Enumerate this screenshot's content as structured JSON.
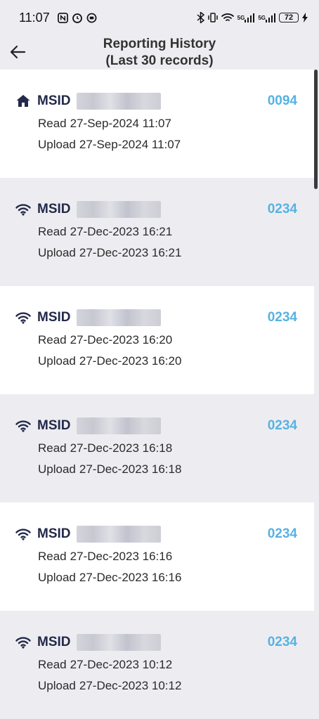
{
  "status_bar": {
    "time": "11:07",
    "battery": "72",
    "signal1": "5G",
    "signal2": "5G"
  },
  "header": {
    "title_line1": "Reporting History",
    "title_line2": "(Last 30 records)"
  },
  "records": [
    {
      "icon": "home-icon",
      "msid_label": "MSID",
      "code": "0094",
      "read_label": "Read",
      "read_time": "27-Sep-2024 11:07",
      "upload_label": "Upload",
      "upload_time": "27-Sep-2024 11:07"
    },
    {
      "icon": "wifi-icon",
      "msid_label": "MSID",
      "code": "0234",
      "read_label": "Read",
      "read_time": "27-Dec-2023 16:21",
      "upload_label": "Upload",
      "upload_time": "27-Dec-2023 16:21"
    },
    {
      "icon": "wifi-icon",
      "msid_label": "MSID",
      "code": "0234",
      "read_label": "Read",
      "read_time": "27-Dec-2023 16:20",
      "upload_label": "Upload",
      "upload_time": "27-Dec-2023 16:20"
    },
    {
      "icon": "wifi-icon",
      "msid_label": "MSID",
      "code": "0234",
      "read_label": "Read",
      "read_time": "27-Dec-2023 16:18",
      "upload_label": "Upload",
      "upload_time": "27-Dec-2023 16:18"
    },
    {
      "icon": "wifi-icon",
      "msid_label": "MSID",
      "code": "0234",
      "read_label": "Read",
      "read_time": "27-Dec-2023 16:16",
      "upload_label": "Upload",
      "upload_time": "27-Dec-2023 16:16"
    },
    {
      "icon": "wifi-icon",
      "msid_label": "MSID",
      "code": "0234",
      "read_label": "Read",
      "read_time": "27-Dec-2023 10:12",
      "upload_label": "Upload",
      "upload_time": "27-Dec-2023 10:12"
    }
  ],
  "colors": {
    "accent": "#56b2e3",
    "navy": "#23294a"
  }
}
